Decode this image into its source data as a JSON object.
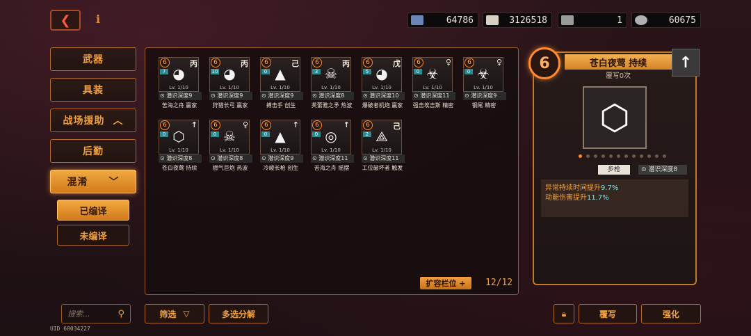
{
  "header": {
    "back_icon": "back-arrow-icon",
    "info_label": "i",
    "resources": [
      {
        "name": "cube-resource",
        "value": "64786",
        "color": "#6a86b8"
      },
      {
        "name": "banknote-resource",
        "value": "3126518",
        "color": "#d8d0c0"
      },
      {
        "name": "ticket-resource",
        "value": "1",
        "color": "#9a9a9a"
      },
      {
        "name": "gear-resource",
        "value": "60675",
        "color": "#b0b0b0"
      }
    ]
  },
  "sidebar": {
    "categories": [
      {
        "label": "武器",
        "active": false
      },
      {
        "label": "具装",
        "active": false
      },
      {
        "label": "战场援助",
        "active": false,
        "chevron": "^"
      },
      {
        "label": "后勤",
        "active": false
      },
      {
        "label": "混淆",
        "active": true,
        "chevron": "v"
      }
    ],
    "subs": [
      {
        "label": "已编译",
        "active": true
      },
      {
        "label": "未编译",
        "active": false
      }
    ]
  },
  "grid": {
    "cards": [
      {
        "tier": "6",
        "lvl": "7",
        "rank": "丙",
        "emblem": "◕",
        "lv_text": "Lv. 1/10",
        "depth": "潜识深度9",
        "name": "苦海之舟 赢家"
      },
      {
        "tier": "6",
        "lvl": "10",
        "rank": "丙",
        "emblem": "◕",
        "lv_text": "Lv. 1/10",
        "depth": "潜识深度9",
        "name": "狩猎长弓 赢家"
      },
      {
        "tier": "6",
        "lvl": "0",
        "rank": "己",
        "emblem": "▲",
        "lv_text": "Lv. 1/10",
        "depth": "潜识深度9",
        "name": "搏击手 创生"
      },
      {
        "tier": "6",
        "lvl": "3",
        "rank": "丙",
        "emblem": "☠",
        "lv_text": "Lv. 1/10",
        "depth": "潜识深度8",
        "name": "芙蕾雅之矛 热波"
      },
      {
        "tier": "6",
        "lvl": "5",
        "rank": "戊",
        "emblem": "◕",
        "lv_text": "Lv. 1/10",
        "depth": "潜识深度10",
        "name": "爆破者机炮 赢家"
      },
      {
        "tier": "6",
        "lvl": "0",
        "rank": "♀",
        "emblem": "☣",
        "lv_text": "Lv. 1/10",
        "depth": "潜识深度11",
        "name": "强击埃吉斯 精密"
      },
      {
        "tier": "6",
        "lvl": "0",
        "rank": "♀",
        "emblem": "☣",
        "lv_text": "Lv. 1/10",
        "depth": "潜识深度9",
        "name": "钢尾 精密"
      },
      {
        "tier": "6",
        "lvl": "0",
        "rank": "↑",
        "emblem": "⬡",
        "lv_text": "Lv. 1/10",
        "depth": "潜识深度8",
        "name": "苍白夜莺 持续"
      },
      {
        "tier": "6",
        "lvl": "0",
        "rank": "♀",
        "emblem": "☠",
        "lv_text": "Lv. 1/10",
        "depth": "潜识深度8",
        "name": "燃气巨炮 热波"
      },
      {
        "tier": "6",
        "lvl": "0",
        "rank": "↑",
        "emblem": "▲",
        "lv_text": "Lv. 1/10",
        "depth": "潜识深度9",
        "name": "冷峻长枪 创生"
      },
      {
        "tier": "6",
        "lvl": "0",
        "rank": "↑",
        "emblem": "◎",
        "lv_text": "Lv. 1/10",
        "depth": "潜识深度11",
        "name": "苦海之舟 摇摆"
      },
      {
        "tier": "6",
        "lvl": "2",
        "rank": "己",
        "emblem": "⟁",
        "lv_text": "Lv. 1/10",
        "depth": "潜识深度11",
        "name": "工位破坏者 触发"
      }
    ],
    "expand_label": "扩容栏位 +",
    "slot_count": "12/12"
  },
  "detail": {
    "tier": "6",
    "title": "苍白夜莺 持续",
    "subtitle": "覆写0次",
    "rank": "↑",
    "emblem": "⬡",
    "weapon_tag": "步枪",
    "depth_tag": "潜识深度8",
    "effects": [
      {
        "text": "异常持续时间提升",
        "value": "9.7%"
      },
      {
        "text": "动能伤害提升",
        "value": "11.7%"
      }
    ]
  },
  "footer": {
    "search_placeholder": "搜索...",
    "uid": "UID 60034227",
    "filter_label": "筛选",
    "multi_label": "多选分解",
    "overwrite_label": "覆写",
    "strengthen_label": "强化"
  }
}
